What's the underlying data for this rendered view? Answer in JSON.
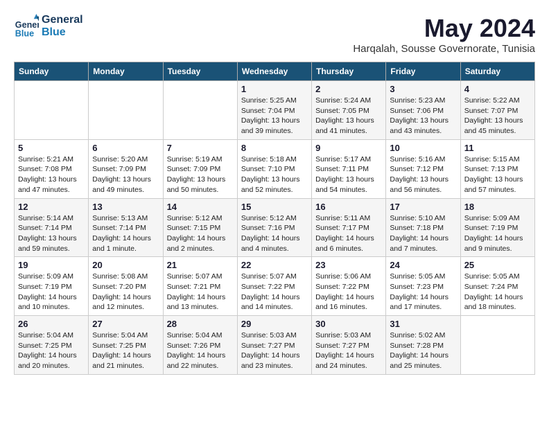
{
  "header": {
    "logo_line1": "General",
    "logo_line2": "Blue",
    "month": "May 2024",
    "location": "Harqalah, Sousse Governorate, Tunisia"
  },
  "weekdays": [
    "Sunday",
    "Monday",
    "Tuesday",
    "Wednesday",
    "Thursday",
    "Friday",
    "Saturday"
  ],
  "weeks": [
    [
      {
        "day": "",
        "info": ""
      },
      {
        "day": "",
        "info": ""
      },
      {
        "day": "",
        "info": ""
      },
      {
        "day": "1",
        "info": "Sunrise: 5:25 AM\nSunset: 7:04 PM\nDaylight: 13 hours\nand 39 minutes."
      },
      {
        "day": "2",
        "info": "Sunrise: 5:24 AM\nSunset: 7:05 PM\nDaylight: 13 hours\nand 41 minutes."
      },
      {
        "day": "3",
        "info": "Sunrise: 5:23 AM\nSunset: 7:06 PM\nDaylight: 13 hours\nand 43 minutes."
      },
      {
        "day": "4",
        "info": "Sunrise: 5:22 AM\nSunset: 7:07 PM\nDaylight: 13 hours\nand 45 minutes."
      }
    ],
    [
      {
        "day": "5",
        "info": "Sunrise: 5:21 AM\nSunset: 7:08 PM\nDaylight: 13 hours\nand 47 minutes."
      },
      {
        "day": "6",
        "info": "Sunrise: 5:20 AM\nSunset: 7:09 PM\nDaylight: 13 hours\nand 49 minutes."
      },
      {
        "day": "7",
        "info": "Sunrise: 5:19 AM\nSunset: 7:09 PM\nDaylight: 13 hours\nand 50 minutes."
      },
      {
        "day": "8",
        "info": "Sunrise: 5:18 AM\nSunset: 7:10 PM\nDaylight: 13 hours\nand 52 minutes."
      },
      {
        "day": "9",
        "info": "Sunrise: 5:17 AM\nSunset: 7:11 PM\nDaylight: 13 hours\nand 54 minutes."
      },
      {
        "day": "10",
        "info": "Sunrise: 5:16 AM\nSunset: 7:12 PM\nDaylight: 13 hours\nand 56 minutes."
      },
      {
        "day": "11",
        "info": "Sunrise: 5:15 AM\nSunset: 7:13 PM\nDaylight: 13 hours\nand 57 minutes."
      }
    ],
    [
      {
        "day": "12",
        "info": "Sunrise: 5:14 AM\nSunset: 7:14 PM\nDaylight: 13 hours\nand 59 minutes."
      },
      {
        "day": "13",
        "info": "Sunrise: 5:13 AM\nSunset: 7:14 PM\nDaylight: 14 hours\nand 1 minute."
      },
      {
        "day": "14",
        "info": "Sunrise: 5:12 AM\nSunset: 7:15 PM\nDaylight: 14 hours\nand 2 minutes."
      },
      {
        "day": "15",
        "info": "Sunrise: 5:12 AM\nSunset: 7:16 PM\nDaylight: 14 hours\nand 4 minutes."
      },
      {
        "day": "16",
        "info": "Sunrise: 5:11 AM\nSunset: 7:17 PM\nDaylight: 14 hours\nand 6 minutes."
      },
      {
        "day": "17",
        "info": "Sunrise: 5:10 AM\nSunset: 7:18 PM\nDaylight: 14 hours\nand 7 minutes."
      },
      {
        "day": "18",
        "info": "Sunrise: 5:09 AM\nSunset: 7:19 PM\nDaylight: 14 hours\nand 9 minutes."
      }
    ],
    [
      {
        "day": "19",
        "info": "Sunrise: 5:09 AM\nSunset: 7:19 PM\nDaylight: 14 hours\nand 10 minutes."
      },
      {
        "day": "20",
        "info": "Sunrise: 5:08 AM\nSunset: 7:20 PM\nDaylight: 14 hours\nand 12 minutes."
      },
      {
        "day": "21",
        "info": "Sunrise: 5:07 AM\nSunset: 7:21 PM\nDaylight: 14 hours\nand 13 minutes."
      },
      {
        "day": "22",
        "info": "Sunrise: 5:07 AM\nSunset: 7:22 PM\nDaylight: 14 hours\nand 14 minutes."
      },
      {
        "day": "23",
        "info": "Sunrise: 5:06 AM\nSunset: 7:22 PM\nDaylight: 14 hours\nand 16 minutes."
      },
      {
        "day": "24",
        "info": "Sunrise: 5:05 AM\nSunset: 7:23 PM\nDaylight: 14 hours\nand 17 minutes."
      },
      {
        "day": "25",
        "info": "Sunrise: 5:05 AM\nSunset: 7:24 PM\nDaylight: 14 hours\nand 18 minutes."
      }
    ],
    [
      {
        "day": "26",
        "info": "Sunrise: 5:04 AM\nSunset: 7:25 PM\nDaylight: 14 hours\nand 20 minutes."
      },
      {
        "day": "27",
        "info": "Sunrise: 5:04 AM\nSunset: 7:25 PM\nDaylight: 14 hours\nand 21 minutes."
      },
      {
        "day": "28",
        "info": "Sunrise: 5:04 AM\nSunset: 7:26 PM\nDaylight: 14 hours\nand 22 minutes."
      },
      {
        "day": "29",
        "info": "Sunrise: 5:03 AM\nSunset: 7:27 PM\nDaylight: 14 hours\nand 23 minutes."
      },
      {
        "day": "30",
        "info": "Sunrise: 5:03 AM\nSunset: 7:27 PM\nDaylight: 14 hours\nand 24 minutes."
      },
      {
        "day": "31",
        "info": "Sunrise: 5:02 AM\nSunset: 7:28 PM\nDaylight: 14 hours\nand 25 minutes."
      },
      {
        "day": "",
        "info": ""
      }
    ]
  ]
}
